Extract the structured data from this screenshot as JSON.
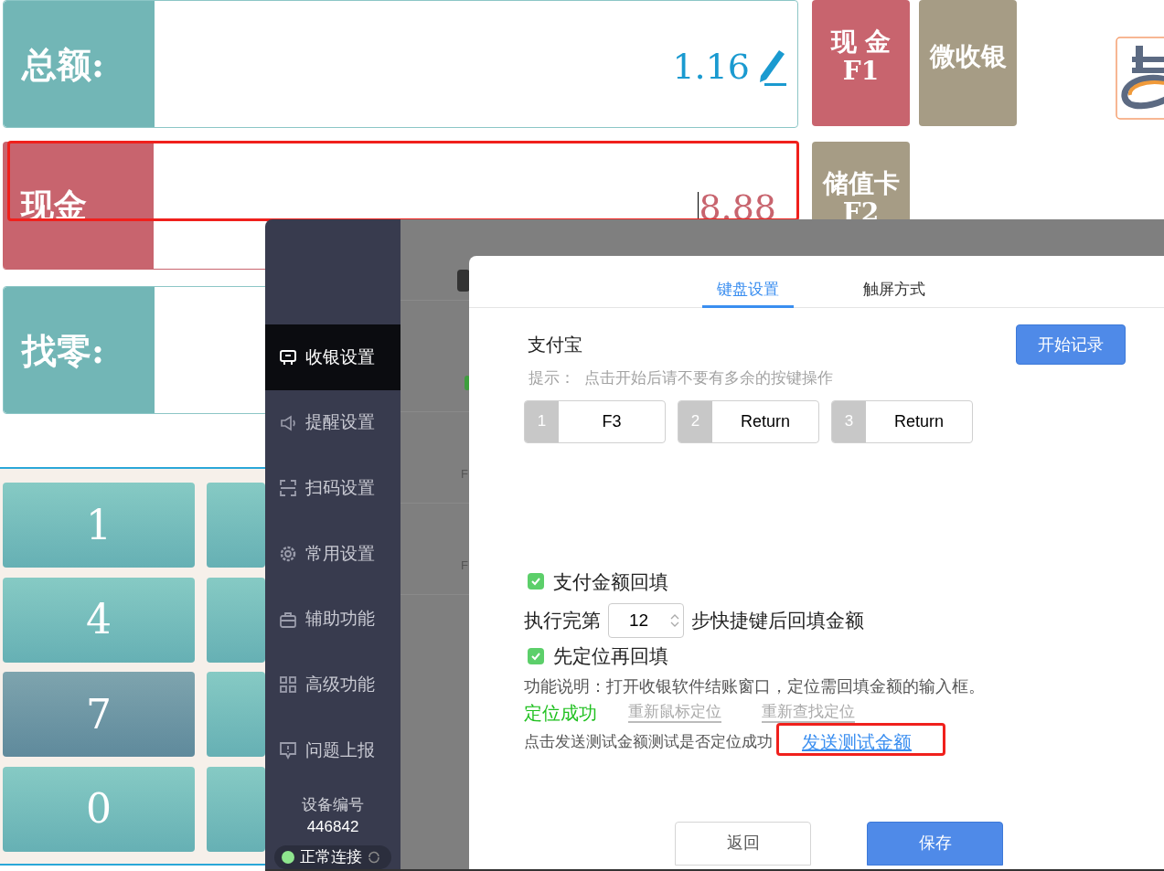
{
  "pos": {
    "total": {
      "label": "总额:",
      "value": "1.16"
    },
    "cash": {
      "label": "现金",
      "value": "8.88"
    },
    "change": {
      "label": "找零:"
    },
    "pay_buttons": [
      {
        "label": "现 金",
        "key": "F1",
        "kind": "cash"
      },
      {
        "label": "微收银",
        "kind": "wechat"
      },
      {
        "label": "储值卡",
        "key": "F2",
        "kind": "card"
      }
    ],
    "keypad": [
      {
        "label": "1",
        "selected": false
      },
      {
        "label": "4",
        "selected": false
      },
      {
        "label": "7",
        "selected": true
      },
      {
        "label": "0",
        "selected": false
      }
    ]
  },
  "settings": {
    "sidebar": {
      "items": [
        {
          "label": "收银设置",
          "kind": "register",
          "selected": true
        },
        {
          "label": "提醒设置",
          "kind": "speaker",
          "selected": false
        },
        {
          "label": "扫码设置",
          "kind": "scan",
          "selected": false
        },
        {
          "label": "常用设置",
          "kind": "gear",
          "selected": false
        },
        {
          "label": "辅助功能",
          "kind": "toolbox",
          "selected": false
        },
        {
          "label": "高级功能",
          "kind": "grid",
          "selected": false
        },
        {
          "label": "问题上报",
          "kind": "report",
          "selected": false
        }
      ],
      "device_label": "设备编号",
      "device_id": "446842",
      "status": "正常连接"
    },
    "background_rows": [
      "F",
      "F"
    ],
    "dialog": {
      "tabs": [
        {
          "label": "键盘设置",
          "selected": true
        },
        {
          "label": "触屏方式",
          "selected": false
        }
      ],
      "title": "支付宝",
      "start_button": "开始记录",
      "hint_label": "提示：",
      "hint": "点击开始后请不要有多余的按键操作",
      "keys": [
        {
          "index": "1",
          "value": "F3"
        },
        {
          "index": "2",
          "value": "Return"
        },
        {
          "index": "3",
          "value": "Return"
        }
      ],
      "fill_back": {
        "label": "支付金额回填",
        "checked": true
      },
      "steps": {
        "before": "执行完第",
        "value": "12",
        "after": "步快捷键后回填金额"
      },
      "locate_first": {
        "label": "先定位再回填",
        "checked": true
      },
      "description": "功能说明：打开收银软件结账窗口，定位需回填金额的输入框。",
      "locate_status": "定位成功",
      "relocate_mouse": "重新鼠标定位",
      "relocate_find": "重新查找定位",
      "test_hint": "点击发送测试金额测试是否定位成功",
      "test_link": "发送测试金额",
      "buttons": [
        {
          "label": "返回",
          "kind": "secondary"
        },
        {
          "label": "保存",
          "kind": "primary"
        }
      ]
    }
  }
}
